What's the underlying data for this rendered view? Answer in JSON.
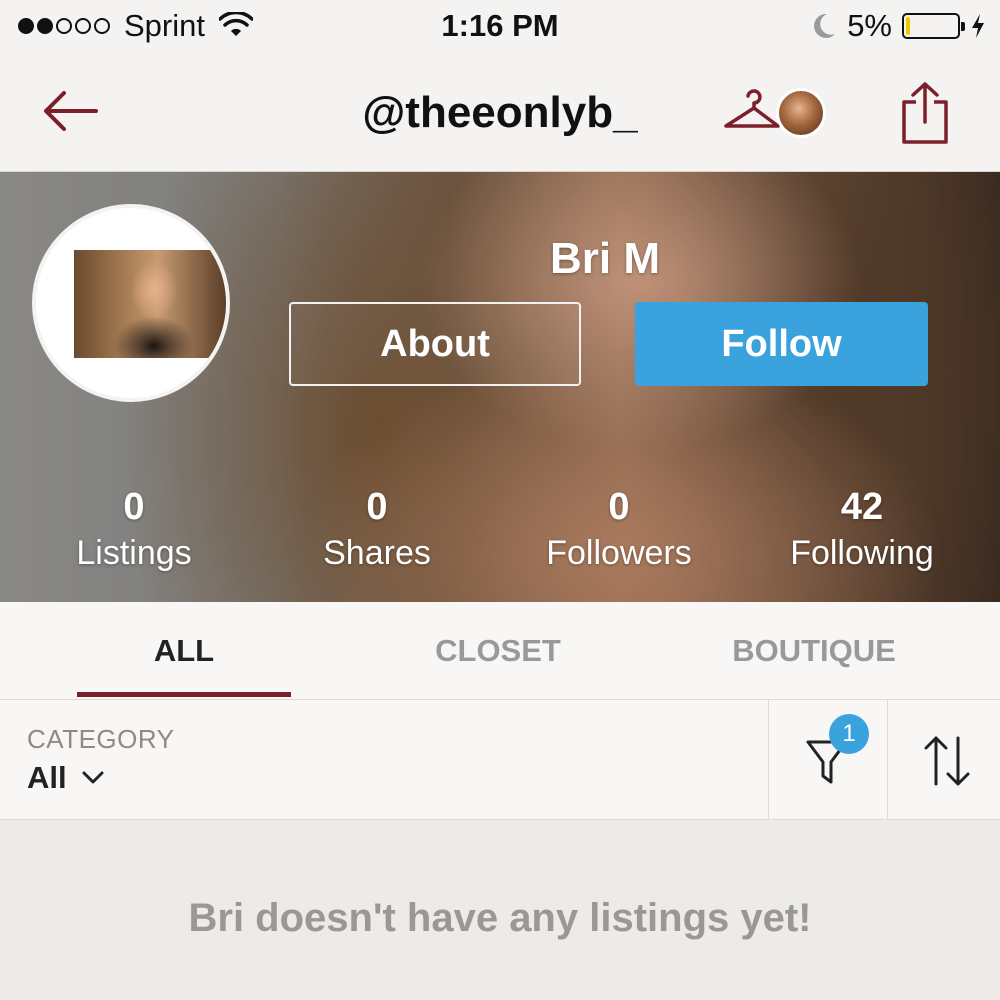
{
  "status_bar": {
    "carrier": "Sprint",
    "time": "1:16 PM",
    "battery_percent": "5%",
    "battery_level": 0.05,
    "signal_bars": 2
  },
  "nav": {
    "title": "@theeonlyb_",
    "icons": [
      "back-arrow-icon",
      "hanger-icon",
      "share-icon"
    ]
  },
  "profile": {
    "name": "Bri M",
    "about_label": "About",
    "follow_label": "Follow",
    "stats": [
      {
        "value": "0",
        "label": "Listings"
      },
      {
        "value": "0",
        "label": "Shares"
      },
      {
        "value": "0",
        "label": "Followers"
      },
      {
        "value": "42",
        "label": "Following"
      }
    ]
  },
  "tabs": [
    {
      "label": "ALL",
      "active": true
    },
    {
      "label": "CLOSET",
      "active": false
    },
    {
      "label": "BOUTIQUE",
      "active": false
    }
  ],
  "filter": {
    "category_label": "CATEGORY",
    "category_value": "All",
    "filter_count": "1"
  },
  "empty_state": {
    "message": "Bri doesn't have any listings yet!"
  },
  "colors": {
    "accent": "#7b1f2b",
    "follow_blue": "#3aa2dc",
    "muted_text": "#9a9894"
  }
}
